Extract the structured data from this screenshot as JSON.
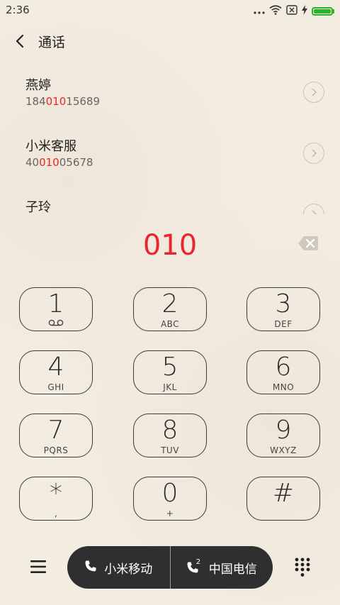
{
  "status_bar": {
    "time": "2:36",
    "battery_level": 1.0,
    "icons": [
      "more-dots-icon",
      "wifi-icon",
      "no-sim-icon",
      "charging-icon",
      "battery-icon"
    ]
  },
  "header": {
    "title": "通话"
  },
  "contacts": [
    {
      "name": "燕婷",
      "num_prefix": "184",
      "num_match": "010",
      "num_suffix": "15689"
    },
    {
      "name": "小米客服",
      "num_prefix": "40",
      "num_match": "010",
      "num_suffix": "05678"
    },
    {
      "name": "子玲",
      "num_prefix": "",
      "num_match": "",
      "num_suffix": ""
    }
  ],
  "dialer": {
    "input": "010"
  },
  "keypad": [
    {
      "digit": "1",
      "letters": ""
    },
    {
      "digit": "2",
      "letters": "ABC"
    },
    {
      "digit": "3",
      "letters": "DEF"
    },
    {
      "digit": "4",
      "letters": "GHI"
    },
    {
      "digit": "5",
      "letters": "JKL"
    },
    {
      "digit": "6",
      "letters": "MNO"
    },
    {
      "digit": "7",
      "letters": "PQRS"
    },
    {
      "digit": "8",
      "letters": "TUV"
    },
    {
      "digit": "9",
      "letters": "WXYZ"
    },
    {
      "digit": "*",
      "letters": ","
    },
    {
      "digit": "0",
      "letters": "+"
    },
    {
      "digit": "#",
      "letters": ""
    }
  ],
  "bottom": {
    "sim1_label": "小米移动",
    "sim2_label": "中国电信",
    "sim2_index": "2"
  },
  "colors": {
    "accent": "#e8262b",
    "background": "#f3ece1",
    "pill": "#2f2f2f",
    "battery": "#2db12d"
  }
}
